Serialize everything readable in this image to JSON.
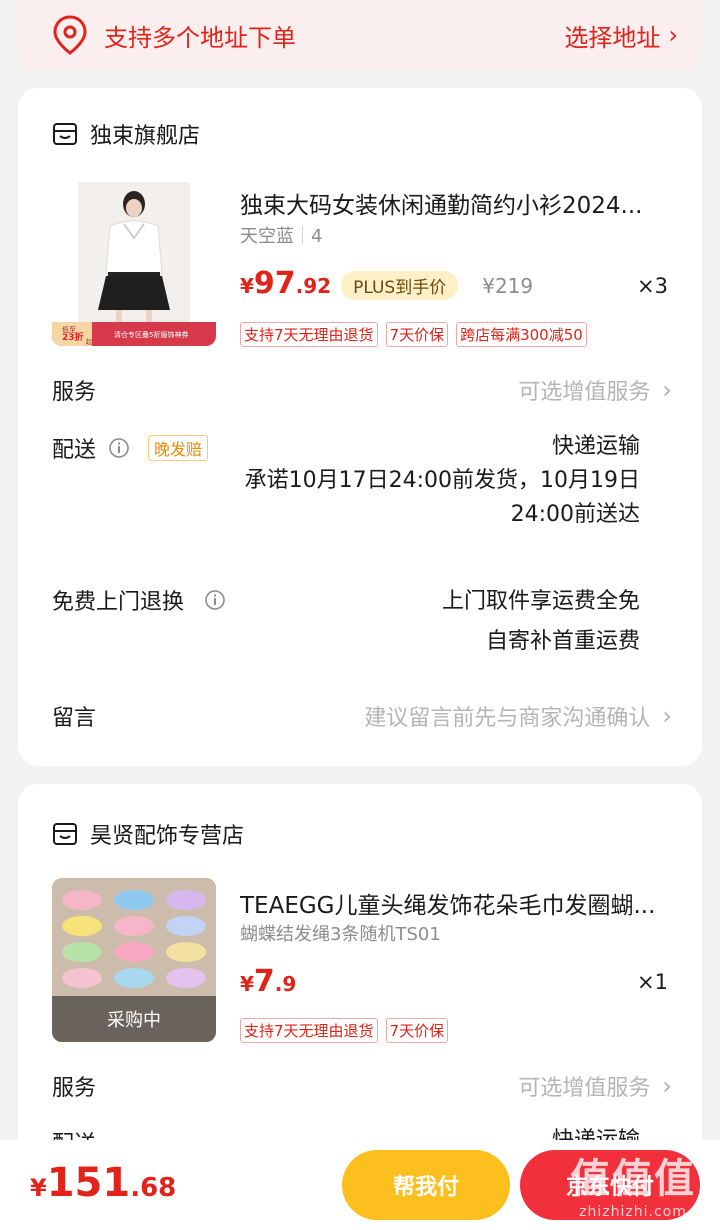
{
  "address": {
    "multi_label": "支持多个地址下单",
    "choose_label": "选择地址"
  },
  "order1": {
    "shop_name": "独束旗舰店",
    "product_title": "独束大码女装休闲通勤简约小衫2024...",
    "spec_color": "天空蓝",
    "spec_size": "4",
    "price_yen": "¥",
    "price_int": "97",
    "price_dec": ".92",
    "plus_badge": "PLUS到手价",
    "original_price": "¥219",
    "quantity": "×3",
    "tags": [
      "支持7天无理由退货",
      "7天价保",
      "跨店每满300减50"
    ],
    "service_label": "服务",
    "service_value": "可选增值服务",
    "delivery_label": "配送",
    "delivery_tag": "晚发赔",
    "delivery_method": "快递运输",
    "delivery_promise_line1": "承诺10月17日24:00前发货，10月19日",
    "delivery_promise_line2": "24:00前送达",
    "return_label": "免费上门退换",
    "return_line1": "上门取件享运费全免",
    "return_line2": "自寄补首重运费",
    "message_label": "留言",
    "message_placeholder": "建议留言前先与商家沟通确认",
    "thumb_banner_left_top": "低至",
    "thumb_banner_left_mid": "23折",
    "thumb_banner_left_bot": "起",
    "thumb_banner_center": "清仓专区叠5折服饰神券"
  },
  "order2": {
    "shop_name": "昊贤配饰专营店",
    "product_title": "TEAEGG儿童头绳发饰花朵毛巾发圈蝴...",
    "spec": "蝴蝶结发绳3条随机TS01",
    "price_yen": "¥",
    "price_int": "7",
    "price_dec": ".9",
    "quantity": "×1",
    "tags": [
      "支持7天无理由退货",
      "7天价保"
    ],
    "thumb_overlay": "采购中",
    "service_label": "服务",
    "service_value": "可选增值服务",
    "delivery_label": "配送",
    "delivery_method": "快递运输"
  },
  "footer": {
    "total_yen": "¥",
    "total_int": "151",
    "total_dec": ".68",
    "help_pay_label": "帮我付",
    "pay_label": "京东快付"
  },
  "watermark": {
    "big": "值值值",
    "url": "zhizhizhi.com"
  },
  "colors": {
    "accent_red": "#e2231a",
    "help_yellow": "#fcbf1e",
    "pay_red": "#f2303b",
    "plus_bg": "#fdf0c6"
  }
}
